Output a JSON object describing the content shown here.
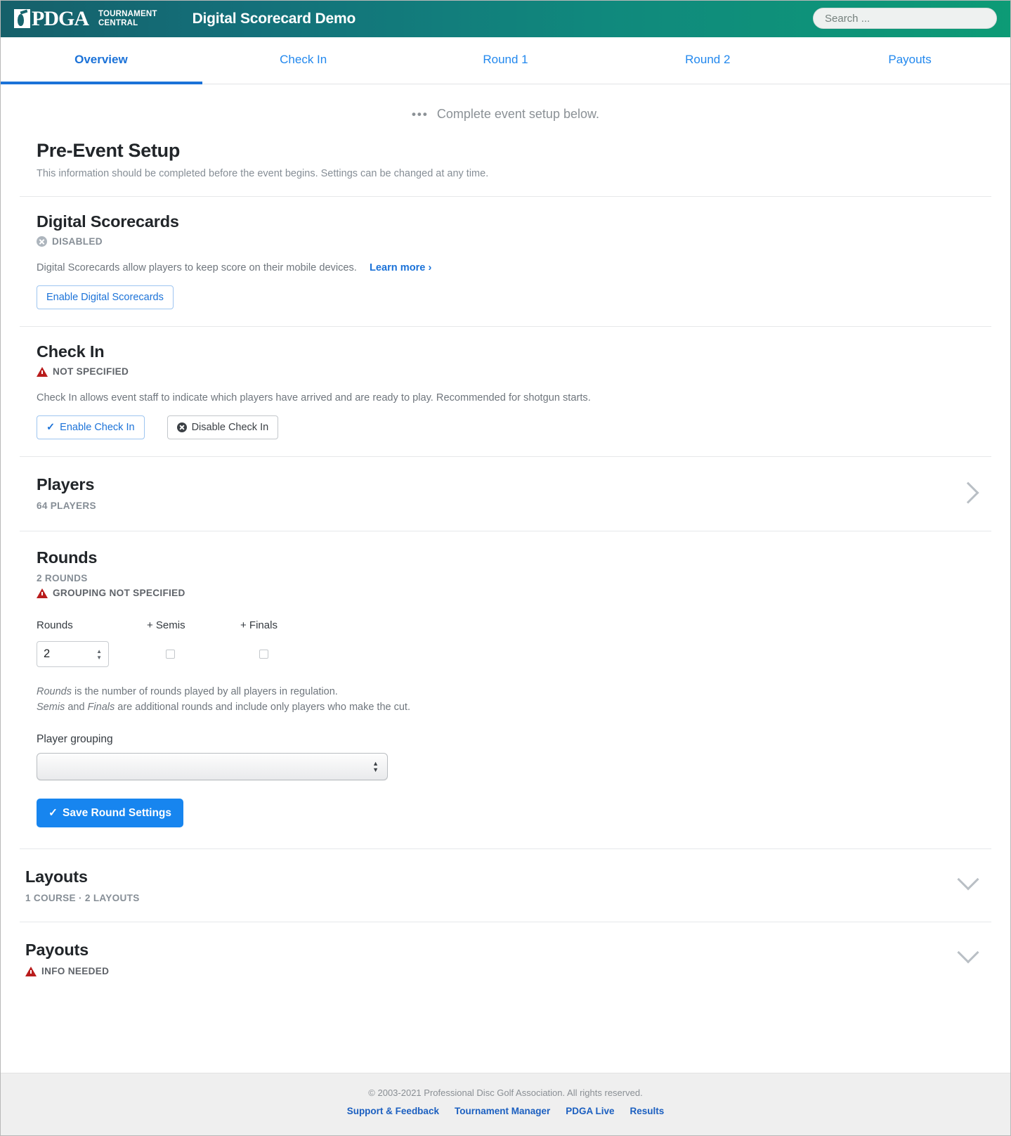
{
  "header": {
    "brand_word": "PDGA",
    "brand_sub_line1": "TOURNAMENT",
    "brand_sub_line2": "CENTRAL",
    "event_title": "Digital Scorecard Demo",
    "search_placeholder": "Search ...",
    "search_value": "",
    "accent_color": "#10897d"
  },
  "tabs": [
    {
      "label": "Overview",
      "active": true
    },
    {
      "label": "Check In",
      "active": false
    },
    {
      "label": "Round 1",
      "active": false
    },
    {
      "label": "Round 2",
      "active": false
    },
    {
      "label": "Payouts",
      "active": false
    }
  ],
  "status": {
    "icon": "ellipsis-icon",
    "text": "Complete event setup below."
  },
  "setup": {
    "title": "Pre-Event Setup",
    "subtitle": "This information should be completed before the event begins. Settings can be changed at any time."
  },
  "digital_scorecards": {
    "title": "Digital Scorecards",
    "status_icon": "circle-x-icon",
    "status": "DISABLED",
    "description": "Digital Scorecards allow players to keep score on their mobile devices.",
    "learn_more": "Learn more ›",
    "enable_button": "Enable Digital Scorecards"
  },
  "check_in": {
    "title": "Check In",
    "status_icon": "warning-triangle-icon",
    "status": "NOT SPECIFIED",
    "description": "Check In allows event staff to indicate which players have arrived and are ready to play. Recommended for shotgun starts.",
    "enable_button": "Enable Check In",
    "disable_button": "Disable Check In"
  },
  "players": {
    "title": "Players",
    "count_label": "64 PLAYERS",
    "chevron": "chevron-right-icon"
  },
  "rounds": {
    "title": "Rounds",
    "count_label": "2 ROUNDS",
    "status_icon": "warning-triangle-icon",
    "status": "GROUPING NOT SPECIFIED",
    "label_rounds": "Rounds",
    "label_semis": "+ Semis",
    "label_finals": "+ Finals",
    "rounds_value": "2",
    "semis_checked": false,
    "finals_checked": false,
    "help_line1_em": "Rounds",
    "help_line1_rest": " is the number of rounds played by all players in regulation.",
    "help_line2_em1": "Semis",
    "help_line2_mid": " and ",
    "help_line2_em2": "Finals",
    "help_line2_rest": " are additional rounds and include only players who make the cut.",
    "grouping_label": "Player grouping",
    "grouping_value": "",
    "save_button": "Save Round Settings"
  },
  "layouts": {
    "title": "Layouts",
    "summary": "1 COURSE · 2 LAYOUTS",
    "chevron": "chevron-down-icon"
  },
  "payouts": {
    "title": "Payouts",
    "status_icon": "warning-triangle-icon",
    "status": "INFO NEEDED",
    "chevron": "chevron-down-icon"
  },
  "footer": {
    "copyright": "© 2003-2021 Professional Disc Golf Association. All rights reserved.",
    "links": [
      "Support & Feedback",
      "Tournament Manager",
      "PDGA Live",
      "Results"
    ]
  }
}
